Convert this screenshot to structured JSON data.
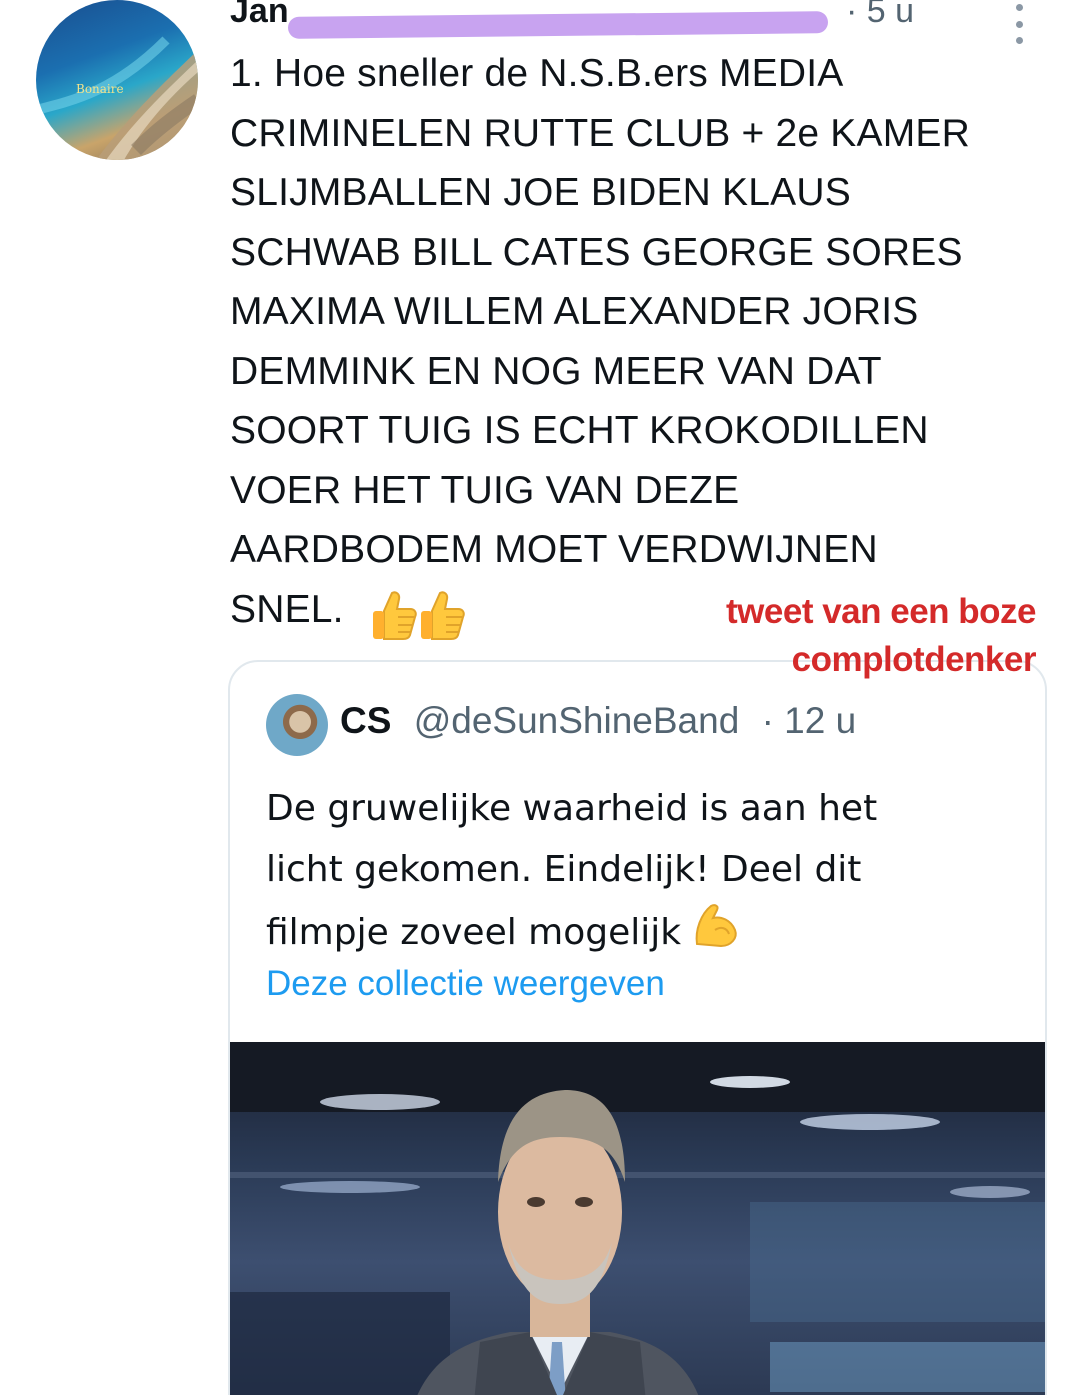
{
  "tweet": {
    "author_name": "Jan",
    "author_handle": "",
    "time": "· 5 u",
    "avatar_label": "Bonaire",
    "lines": [
      "1. Hoe sneller de N.S.B.ers MEDIA",
      "CRIMINELEN RUTTE CLUB + 2e KAMER",
      "SLIJMBALLEN JOE BIDEN KLAUS",
      "SCHWAB BILL CATES GEORGE SORES",
      "MAXIMA WILLEM ALEXANDER JORIS",
      "DEMMINK EN NOG MEER VAN DAT",
      "SOORT TUIG IS ECHT KROKODILLEN",
      "VOER HET TUIG VAN DEZE",
      "AARDBODEM MOET VERDWIJNEN",
      "SNEL."
    ],
    "emoji_icons": [
      "thumbs-up-icon",
      "thumbs-up-icon"
    ]
  },
  "annotation": {
    "lines": [
      "tweet van een boze",
      "complotdenker"
    ],
    "color": "#d42a2a"
  },
  "quote": {
    "name": "CS",
    "handle": "@deSunShineBand",
    "time": "· 12 u",
    "lines": [
      "De gruwelijke waarheid is aan het",
      "licht gekomen. Eindelijk! Deel dit",
      "filmpje zoveel mogelijk"
    ],
    "emoji_icon": "flexed-biceps-icon",
    "link_text": "Deze collectie weergeven",
    "link_color": "#1d9bf0"
  }
}
